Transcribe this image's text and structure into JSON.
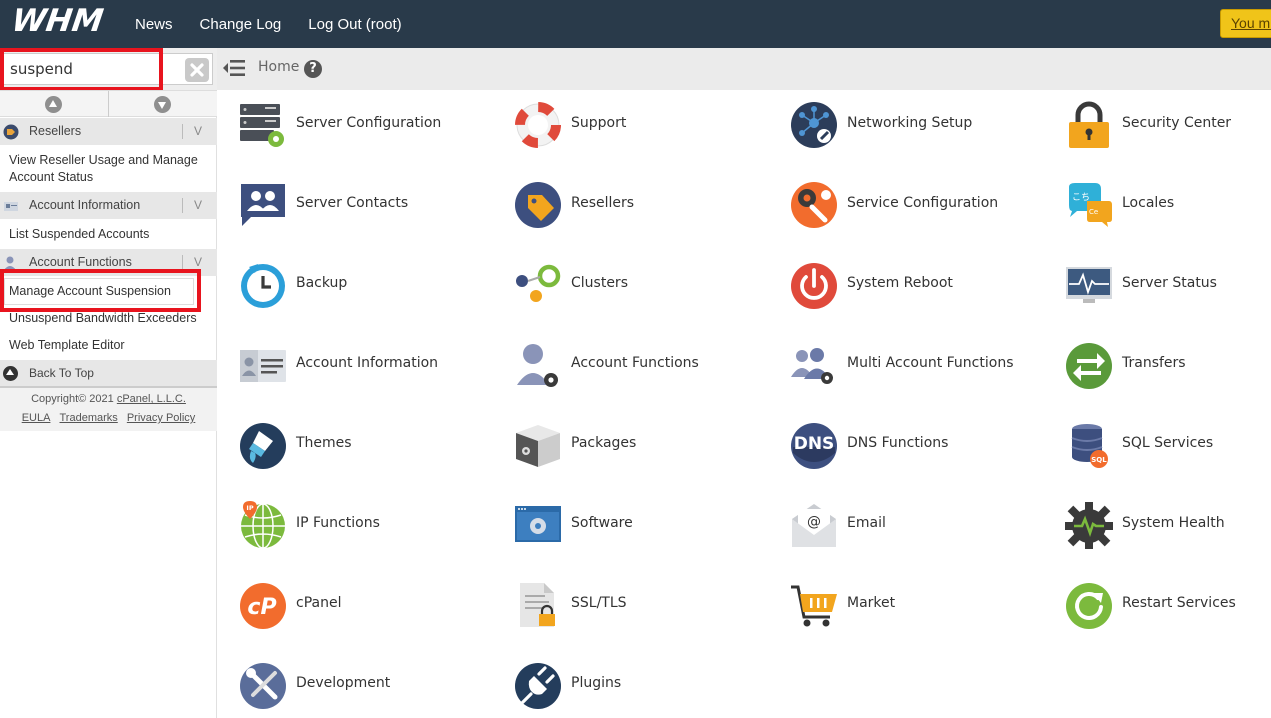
{
  "topbar": {
    "logo": "WHM",
    "nav": [
      "News",
      "Change Log",
      "Log Out (root)"
    ],
    "warning_button": "You mu"
  },
  "search": {
    "value": "suspend",
    "placeholder": ""
  },
  "breadcrumb": {
    "home": "Home",
    "help": "?"
  },
  "sidebar": {
    "sections": [
      {
        "header": "Resellers",
        "items": [
          "View Reseller Usage and Manage Account Status"
        ]
      },
      {
        "header": "Account Information",
        "items": [
          "List Suspended Accounts"
        ]
      },
      {
        "header": "Account Functions",
        "items": [
          "Manage Account Suspension",
          "Unsuspend Bandwidth Exceeders",
          "Web Template Editor"
        ]
      }
    ],
    "back_to_top": "Back To Top",
    "chevron": "V",
    "copyright_prefix": "Copyright© 2021 ",
    "copyright_company": "cPanel, L.L.C.",
    "links": [
      "EULA",
      "Trademarks",
      "Privacy Policy"
    ]
  },
  "grid": [
    {
      "label": "Server Configuration",
      "icon": "server-config-icon"
    },
    {
      "label": "Support",
      "icon": "lifebuoy-icon"
    },
    {
      "label": "Networking Setup",
      "icon": "network-icon"
    },
    {
      "label": "Security Center",
      "icon": "padlock-icon"
    },
    {
      "label": "Server Contacts",
      "icon": "contacts-icon"
    },
    {
      "label": "Resellers",
      "icon": "tag-icon"
    },
    {
      "label": "Service Configuration",
      "icon": "wrench-gear-icon"
    },
    {
      "label": "Locales",
      "icon": "speech-bubbles-icon"
    },
    {
      "label": "Backup",
      "icon": "backup-clock-icon"
    },
    {
      "label": "Clusters",
      "icon": "clusters-icon"
    },
    {
      "label": "System Reboot",
      "icon": "power-icon"
    },
    {
      "label": "Server Status",
      "icon": "monitor-pulse-icon"
    },
    {
      "label": "Account Information",
      "icon": "id-card-icon"
    },
    {
      "label": "Account Functions",
      "icon": "user-gear-icon"
    },
    {
      "label": "Multi Account Functions",
      "icon": "users-gear-icon"
    },
    {
      "label": "Transfers",
      "icon": "transfer-arrows-icon"
    },
    {
      "label": "Themes",
      "icon": "paint-brush-icon"
    },
    {
      "label": "Packages",
      "icon": "package-box-icon"
    },
    {
      "label": "DNS Functions",
      "icon": "dns-icon"
    },
    {
      "label": "SQL Services",
      "icon": "database-icon"
    },
    {
      "label": "IP Functions",
      "icon": "ip-globe-icon"
    },
    {
      "label": "Software",
      "icon": "software-window-icon"
    },
    {
      "label": "Email",
      "icon": "envelope-icon"
    },
    {
      "label": "System Health",
      "icon": "health-gear-icon"
    },
    {
      "label": "cPanel",
      "icon": "cpanel-logo-icon"
    },
    {
      "label": "SSL/TLS",
      "icon": "certificate-lock-icon"
    },
    {
      "label": "Market",
      "icon": "shopping-cart-icon"
    },
    {
      "label": "Restart Services",
      "icon": "restart-icon"
    },
    {
      "label": "Development",
      "icon": "tools-icon"
    },
    {
      "label": "Plugins",
      "icon": "plug-icon"
    }
  ],
  "colors": {
    "topbar": "#293a4a",
    "highlight": "#e8141e",
    "warning": "#f0c419"
  }
}
